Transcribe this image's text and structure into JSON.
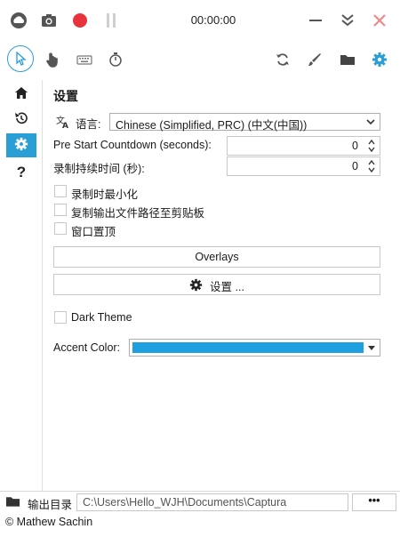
{
  "app": {
    "accent": "#2a9fd6",
    "accent_color_value": "#1e9fe0"
  },
  "titlebar": {
    "timer": "00:00:00",
    "icons": [
      "capture-logo-icon",
      "camera-icon",
      "record-icon",
      "pause-icon",
      "minimize-icon",
      "collapse-icon",
      "close-icon"
    ]
  },
  "toolbar": {
    "tools": [
      "cursor-icon",
      "click-hand-icon",
      "keyboard-icon",
      "stopwatch-icon",
      "refresh-icon",
      "brush-icon",
      "folder-icon",
      "gear-icon"
    ]
  },
  "sidebar": {
    "items": [
      "home-icon",
      "history-icon",
      "gear-icon",
      "help-icon"
    ],
    "active_index": 2,
    "help_glyph": "?"
  },
  "settings": {
    "title": "设置",
    "language_label": "语言:",
    "language_value": "Chinese (Simplified, PRC) (中文(中国))",
    "countdown_label": "Pre Start Countdown (seconds):",
    "countdown_value": "0",
    "duration_label": "录制持续时间 (秒):",
    "duration_value": "0",
    "checkboxes": [
      {
        "label": "录制时最小化",
        "checked": false
      },
      {
        "label": "复制输出文件路径至剪贴板",
        "checked": false
      },
      {
        "label": "窗口置顶",
        "checked": false
      }
    ],
    "overlays_button": "Overlays",
    "settings_button": "设置 ...",
    "dark_theme_label": "Dark Theme",
    "dark_theme_checked": false,
    "accent_label": "Accent Color:"
  },
  "footer": {
    "output_label": "输出目录",
    "output_path": "C:\\Users\\Hello_WJH\\Documents\\Captura",
    "browse_label": "•••",
    "copyright": "© Mathew Sachin"
  }
}
